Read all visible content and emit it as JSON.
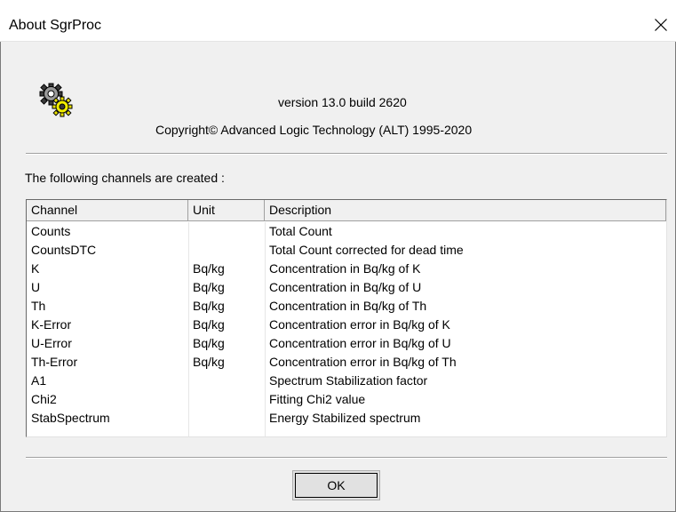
{
  "window": {
    "title": "About SgrProc",
    "close_icon": "close-icon"
  },
  "about": {
    "app_icon": "gears-icon",
    "version": "version 13.0 build 2620",
    "copyright": "Copyright© Advanced Logic Technology (ALT) 1995-2020",
    "channels_label": "The following channels are created :"
  },
  "table": {
    "columns": [
      "Channel",
      "Unit",
      "Description"
    ],
    "rows": [
      [
        "Counts",
        "",
        "Total Count"
      ],
      [
        "CountsDTC",
        "",
        "Total Count corrected for dead time"
      ],
      [
        "K",
        "Bq/kg",
        "Concentration in Bq/kg of  K"
      ],
      [
        "U",
        "Bq/kg",
        "Concentration in Bq/kg of  U"
      ],
      [
        "Th",
        "Bq/kg",
        "Concentration in Bq/kg of  Th"
      ],
      [
        "K-Error",
        "Bq/kg",
        "Concentration error in Bq/kg of  K"
      ],
      [
        "U-Error",
        "Bq/kg",
        "Concentration error in Bq/kg of  U"
      ],
      [
        "Th-Error",
        "Bq/kg",
        "Concentration error in Bq/kg of  Th"
      ],
      [
        "A1",
        "",
        "Spectrum Stabilization factor"
      ],
      [
        "Chi2",
        "",
        "Fitting Chi2 value"
      ],
      [
        "StabSpectrum",
        "",
        "Energy Stabilized spectrum"
      ]
    ]
  },
  "buttons": {
    "ok_label": "OK"
  },
  "colors": {
    "dialog_bg": "#f0f0f0",
    "titlebar_bg": "#ffffff",
    "table_bg": "#ffffff",
    "button_bg": "#e1e1e1"
  }
}
